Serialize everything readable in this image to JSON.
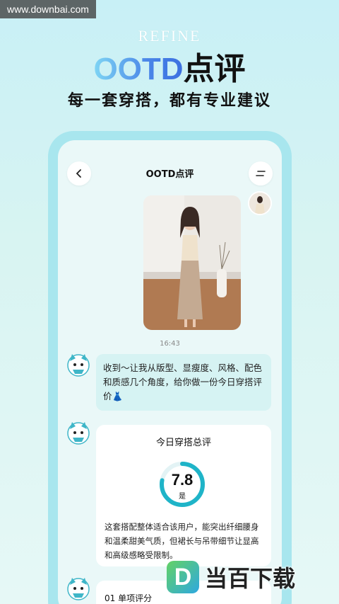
{
  "watermark": {
    "site": "www.downbai.com",
    "logo_letter": "D",
    "logo_text": "当百下载"
  },
  "hero": {
    "brand": "REFINE",
    "title_latin": "OOTD",
    "title_cn": "点评",
    "subtitle": "每一套穿搭，都有专业建议"
  },
  "screen": {
    "title": "OOTD点评",
    "back_icon": "chevron-left-icon",
    "menu_icon": "menu-icon"
  },
  "chat": {
    "time": "16:43",
    "reply": "收到～让我从版型、显瘦度、风格、配色和质感几个角度，给你做一份今日穿搭评价👗",
    "summary": {
      "title": "今日穿搭总评",
      "score": "7.8",
      "grade": "是",
      "score_fraction": 0.78,
      "text": "这套搭配整体适合该用户，能突出纤细腰身和温柔甜美气质，但裙长与吊带细节让显高和高级感略受限制。"
    },
    "section_title": "01 单项评分"
  },
  "colors": {
    "accent": "#1fb4c8",
    "bubble": "#d6f3f3",
    "phone_frame": "#a8e6ee"
  }
}
